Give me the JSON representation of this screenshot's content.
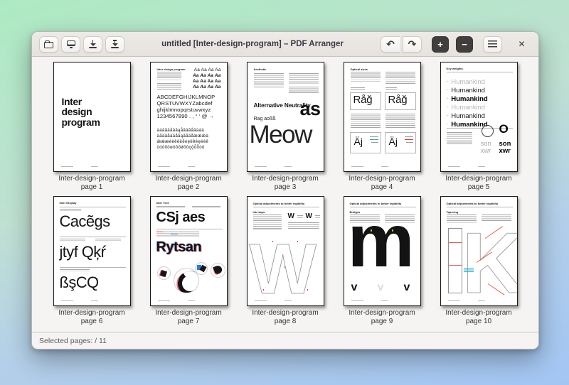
{
  "theme": {
    "bg_top": "#adeac3",
    "bg_mid": "#bfe0d2",
    "bg_low": "#b4cfe9",
    "bg_bottom": "#a2c5f3",
    "header_bg": "#edeae7",
    "header_border": "#c8c2bc",
    "btn_border": "#cfc9c2",
    "icon_color": "#3a3a3a",
    "dark_btn": "#413e3e",
    "window_bg": "#f5f4f2",
    "title_color": "#3d3846",
    "caption_color": "#353535",
    "status_color": "#5f5c59",
    "page_border": "#1b1b1b",
    "greek": "#a6a6a6",
    "rule": "#8f8f8f",
    "gray_text": "#b9b9b9",
    "outline_gray": "#8f8f8f",
    "red": "#df382c",
    "blue": "#2a7de1",
    "cyan": "#31b0d5",
    "green": "#33b579",
    "yellow": "#f2c40e"
  },
  "titlebar": {
    "title": "untitled [Inter-design-program] – PDF Arranger",
    "icons": [
      "folder-open-icon",
      "save-icon",
      "arrow-down-icon",
      "arrow-down-dashed-icon",
      "undo-icon",
      "redo-icon",
      "zoom-in-icon",
      "zoom-out-icon",
      "menu-icon",
      "close-icon"
    ],
    "undo_glyph": "↶",
    "redo_glyph": "↷",
    "zoom_in_glyph": "+",
    "zoom_out_glyph": "−",
    "close_glyph": "✕"
  },
  "statusbar": {
    "selected_label": "Selected pages: / 11"
  },
  "pages": [
    {
      "caption": "Inter-design-program",
      "page_label": "page 1",
      "content": {
        "title": "Inter\ndesign\nprogram"
      }
    },
    {
      "caption": "Inter-design-program",
      "page_label": "page 2",
      "content": {
        "heading": "Inter design program",
        "aa_rows": [
          "Aa Aa Aa Aa",
          "Aa Aa Aa Aa",
          "Aa Aa Aa Aa",
          "Aa Aa Aa Aa"
        ],
        "alphabet": "ABCDEFGHIJKLMNOP\nQRSTUVWXYZabcdef\nghijklmnopqrstuvwxyz\n1234567890 . , “ ‘ @ →",
        "accents": "àáâãäåāăąǻȁȃãåâäáà\nàãäâåáāǻăąâãäåæǽǣà\nǣǽæéèêëēĕėęěȅȇȩéèê\nòóôõöøōŏőǿȍȏǫǭȫȭȯö"
      }
    },
    {
      "caption": "Inter-design-program",
      "page_label": "page 3",
      "content": {
        "heading": "Aesthetic",
        "display_line": "Alternative Neutrality",
        "sub_line": "Rag aoßß",
        "big_right": "as",
        "giant": "Meow"
      }
    },
    {
      "caption": "Inter-design-program",
      "page_label": "page 4",
      "content": {
        "heading": "Optical sizes",
        "box1": "Råğ",
        "box2": "Råğ",
        "box3": "Äj",
        "box4": "Äj"
      }
    },
    {
      "caption": "Inter-design-program",
      "page_label": "page 5",
      "content": {
        "heading": "Key weights",
        "dash": "–",
        "rows": [
          {
            "text": "Humankind"
          },
          {
            "text": "Humankind"
          },
          {
            "text": "Humankind"
          },
          {
            "text": "Humankind"
          },
          {
            "text": "Humankind"
          },
          {
            "text": "Humankind"
          }
        ],
        "o_light": "O",
        "o_bold": "O",
        "sample_light": "son\nxwr",
        "sample_bold": "son\nxwr"
      }
    },
    {
      "caption": "Inter-design-program",
      "page_label": "page 6",
      "content": {
        "heading": "Inter Display",
        "line1": "Cacẽgs",
        "line2": "jtyf Qķŕ",
        "line3": "ßşCQ"
      }
    },
    {
      "caption": "Inter-design-program",
      "page_label": "page 7",
      "content": {
        "heading": "Inter Text",
        "line1": "CSj aes",
        "line2": "Rytsan"
      }
    },
    {
      "caption": "Inter-design-program",
      "page_label": "page 8",
      "content": {
        "heading": "Optical adjustments to better legibility",
        "subheading": "Ink traps",
        "sample": "W",
        "giant": "W"
      }
    },
    {
      "caption": "Inter-design-program",
      "page_label": "page 9",
      "content": {
        "heading": "Optical adjustments to better legibility",
        "subheading": "Bridges",
        "giant": "m",
        "corners": [
          "v",
          "v",
          "v"
        ]
      }
    },
    {
      "caption": "Inter-design-program",
      "page_label": "page 10",
      "content": {
        "heading": "Optical adjustments to better legibility",
        "subheading": "Tapering",
        "giant": "K"
      }
    }
  ]
}
